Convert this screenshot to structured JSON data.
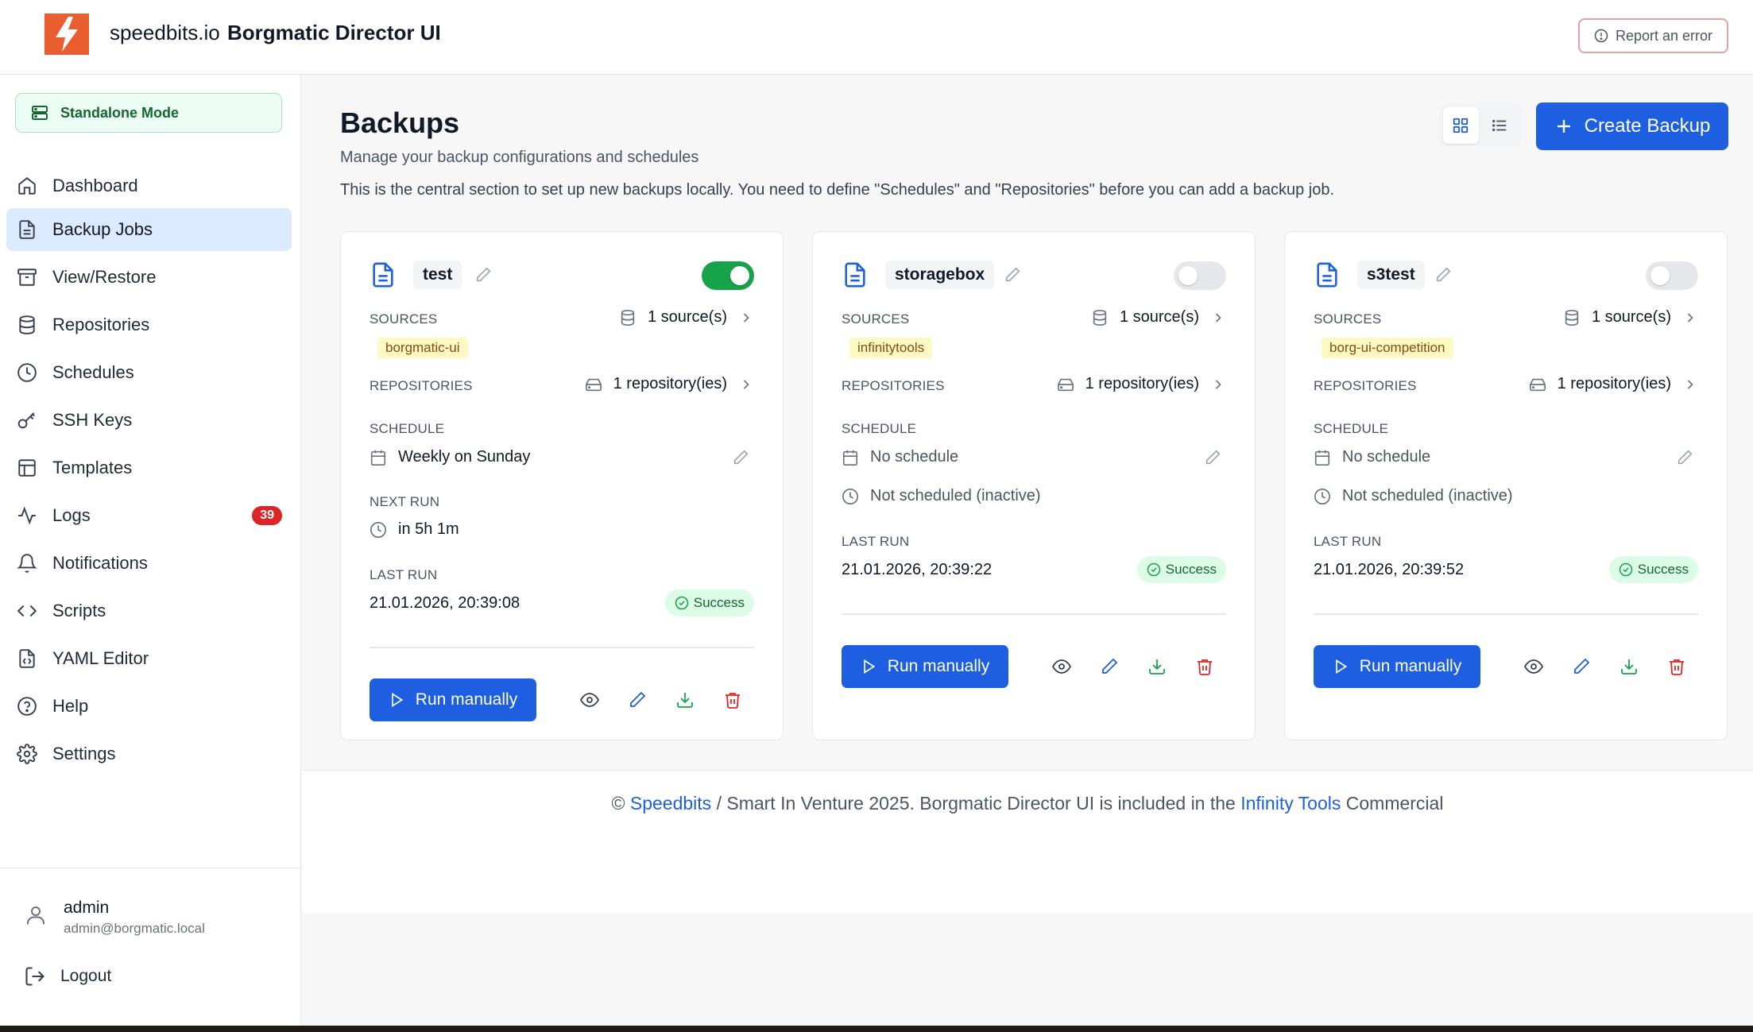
{
  "header": {
    "brand": "speedbits.io",
    "app_title": "Borgmatic Director UI",
    "report_label": "Report an error"
  },
  "colors": {
    "accent": "#1d5fe0",
    "logo": "#e95d2e",
    "success": "#16a34a",
    "danger": "#dc2626"
  },
  "sidebar": {
    "mode_label": "Standalone Mode",
    "items": [
      {
        "label": "Dashboard",
        "icon": "home-icon"
      },
      {
        "label": "Backup Jobs",
        "icon": "file-text-icon",
        "active": true
      },
      {
        "label": "View/Restore",
        "icon": "archive-icon"
      },
      {
        "label": "Repositories",
        "icon": "database-icon"
      },
      {
        "label": "Schedules",
        "icon": "clock-icon"
      },
      {
        "label": "SSH Keys",
        "icon": "key-icon"
      },
      {
        "label": "Templates",
        "icon": "layout-icon"
      },
      {
        "label": "Logs",
        "icon": "activity-icon",
        "badge": "39"
      },
      {
        "label": "Notifications",
        "icon": "bell-icon"
      },
      {
        "label": "Scripts",
        "icon": "code-icon"
      },
      {
        "label": "YAML Editor",
        "icon": "file-code-icon"
      },
      {
        "label": "Help",
        "icon": "help-circle-icon"
      },
      {
        "label": "Settings",
        "icon": "settings-icon"
      }
    ],
    "user": {
      "name": "admin",
      "email": "admin@borgmatic.local"
    },
    "logout_label": "Logout"
  },
  "main": {
    "title": "Backups",
    "subtitle": "Manage your backup configurations and schedules",
    "description": "This is the central section to set up new backups locally. You need to define \"Schedules\" and \"Repositories\" before you can add a backup job.",
    "create_label": "Create Backup",
    "labels": {
      "sources": "SOURCES",
      "repositories": "REPOSITORIES",
      "schedule": "SCHEDULE",
      "next_run": "NEXT RUN",
      "last_run": "LAST RUN",
      "run_manually": "Run manually"
    },
    "cards": [
      {
        "name": "test",
        "enabled": true,
        "sources_count": "1 source(s)",
        "source_tag": "borgmatic-ui",
        "repos_count": "1 repository(ies)",
        "schedule": "Weekly on Sunday",
        "next_run": "in 5h 1m",
        "last_run": "21.01.2026, 20:39:08",
        "status": "Success"
      },
      {
        "name": "storagebox",
        "enabled": false,
        "sources_count": "1 source(s)",
        "source_tag": "infinitytools",
        "repos_count": "1 repository(ies)",
        "schedule": "No schedule",
        "not_scheduled": "Not scheduled (inactive)",
        "last_run": "21.01.2026, 20:39:22",
        "status": "Success"
      },
      {
        "name": "s3test",
        "enabled": false,
        "sources_count": "1 source(s)",
        "source_tag": "borg-ui-competition",
        "repos_count": "1 repository(ies)",
        "schedule": "No schedule",
        "not_scheduled": "Not scheduled (inactive)",
        "last_run": "21.01.2026, 20:39:52",
        "status": "Success"
      }
    ]
  },
  "footer": {
    "prefix": "©",
    "link1": "Speedbits",
    "middle": "/ Smart In Venture 2025. Borgmatic Director UI is included in the",
    "link2": "Infinity Tools",
    "suffix": "Commercial"
  }
}
